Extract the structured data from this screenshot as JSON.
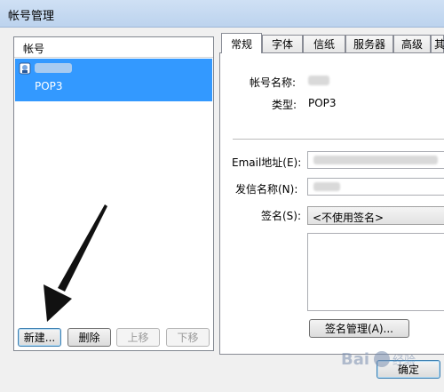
{
  "window": {
    "title": "帐号管理"
  },
  "accounts": {
    "header": "帐号",
    "items": [
      {
        "type": "POP3"
      }
    ]
  },
  "buttons": {
    "new": "新建...",
    "delete": "删除",
    "move_up": "上移",
    "move_down": "下移",
    "signature_manage": "签名管理(A)...",
    "ok": "确定"
  },
  "tabs": [
    "常规",
    "字体",
    "信纸",
    "服务器",
    "高级",
    "其"
  ],
  "general": {
    "account_name_label": "帐号名称:",
    "type_label": "类型:",
    "type_value": "POP3",
    "email_label": "Email地址(E):",
    "sender_label": "发信名称(N):",
    "signature_label": "签名(S):",
    "signature_select": "<不使用签名>"
  },
  "watermark": {
    "text": "Bai 经验"
  },
  "colors": {
    "selection": "#3399ff",
    "titlebar": "#c4d8f1"
  }
}
